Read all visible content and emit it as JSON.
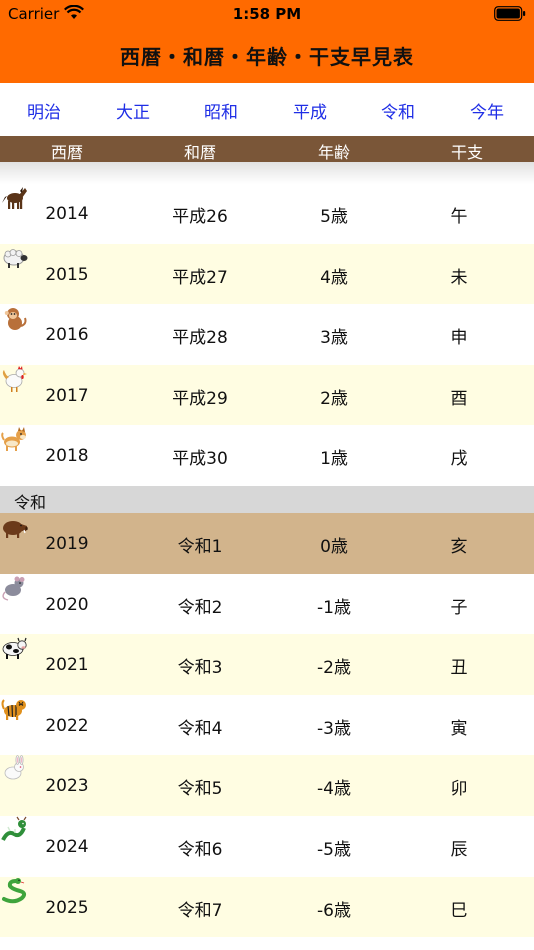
{
  "status_bar": {
    "carrier": "Carrier",
    "time": "1:58 PM"
  },
  "app": {
    "title": "西暦・和暦・年齢・干支早見表",
    "accent": "#ff6a00"
  },
  "era_tabs": [
    "明治",
    "大正",
    "昭和",
    "平成",
    "令和",
    "今年"
  ],
  "columns": [
    "西暦",
    "和暦",
    "年齢",
    "干支"
  ],
  "rows_heisei": [
    {
      "year": "2014",
      "wareki": "平成26",
      "age": "5歳",
      "eto": "午",
      "animal": "horse-icon"
    },
    {
      "year": "2015",
      "wareki": "平成27",
      "age": "4歳",
      "eto": "未",
      "animal": "sheep-icon"
    },
    {
      "year": "2016",
      "wareki": "平成28",
      "age": "3歳",
      "eto": "申",
      "animal": "monkey-icon"
    },
    {
      "year": "2017",
      "wareki": "平成29",
      "age": "2歳",
      "eto": "酉",
      "animal": "rooster-icon"
    },
    {
      "year": "2018",
      "wareki": "平成30",
      "age": "1歳",
      "eto": "戌",
      "animal": "dog-icon"
    }
  ],
  "section_reiwa": "令和",
  "rows_reiwa": [
    {
      "year": "2019",
      "wareki": "令和1",
      "age": "0歳",
      "eto": "亥",
      "animal": "boar-icon"
    },
    {
      "year": "2020",
      "wareki": "令和2",
      "age": "-1歳",
      "eto": "子",
      "animal": "rat-icon"
    },
    {
      "year": "2021",
      "wareki": "令和3",
      "age": "-2歳",
      "eto": "丑",
      "animal": "ox-icon"
    },
    {
      "year": "2022",
      "wareki": "令和4",
      "age": "-3歳",
      "eto": "寅",
      "animal": "tiger-icon"
    },
    {
      "year": "2023",
      "wareki": "令和5",
      "age": "-4歳",
      "eto": "卯",
      "animal": "rabbit-icon"
    },
    {
      "year": "2024",
      "wareki": "令和6",
      "age": "-5歳",
      "eto": "辰",
      "animal": "dragon-icon"
    },
    {
      "year": "2025",
      "wareki": "令和7",
      "age": "-6歳",
      "eto": "巳",
      "animal": "snake-icon"
    }
  ]
}
